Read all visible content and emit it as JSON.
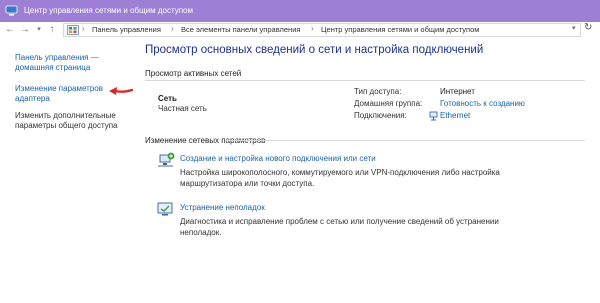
{
  "window": {
    "title": "Центр управления сетями и общим доступом"
  },
  "address_bar": {
    "crumbs": [
      "Панель управления",
      "Все элементы панели управления",
      "Центр управления сетями и общим доступом"
    ],
    "sep": "›",
    "back_icon": "arrow-left-icon",
    "forward_icon": "arrow-right-icon",
    "up_icon": "arrow-up-icon",
    "refresh_icon": "refresh-icon"
  },
  "left_pane": {
    "home_link": "Панель управления —\nдомашняя страница",
    "adapter_link": "Изменение параметров\nадаптера",
    "sharing_link": "Изменить дополнительные\nпараметры общего доступа"
  },
  "main": {
    "title": "Просмотр основных сведений о сети и настройка подключений",
    "active_networks_header": "Просмотр активных сетей",
    "network": {
      "name": "Сеть",
      "type": "Частная сеть",
      "access_type_label": "Тип доступа:",
      "access_type_value": "Интернет",
      "homegroup_label": "Домашняя группа:",
      "homegroup_value": "Готовность к созданию",
      "connections_label": "Подключения:",
      "connections_value": "Ethernet"
    },
    "change_settings_header": "Изменение сетевых параметров",
    "tasks": [
      {
        "title": "Создание и настройка нового подключения или сети",
        "description": "Настройка широкополосного, коммутируемого или VPN-подключения либо настройка маршрутизатора или точки доступа."
      },
      {
        "title": "Устранение неполадок",
        "description": "Диагностика и исправление проблем с сетью или получение сведений об устранении неполадок."
      }
    ]
  },
  "colors": {
    "titlebar": "#9d7fd6",
    "link": "#1c63a8",
    "main_title": "#1e3287",
    "annotation_arrow": "#d42a2a"
  }
}
